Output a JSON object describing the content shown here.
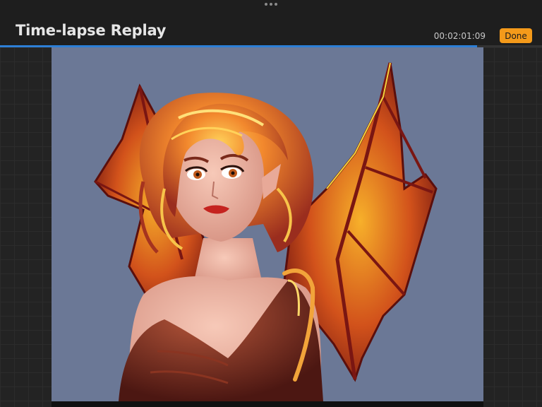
{
  "header": {
    "title": "Time-lapse Replay",
    "timecode": "00:02:01:09",
    "done_label": "Done"
  },
  "playback": {
    "progress": 0.88
  },
  "colors": {
    "accent": "#f49a1a",
    "progress": "#2d7fd6",
    "canvas_background": "#6b7896"
  },
  "icons": {
    "handle": "more-dots-icon"
  }
}
